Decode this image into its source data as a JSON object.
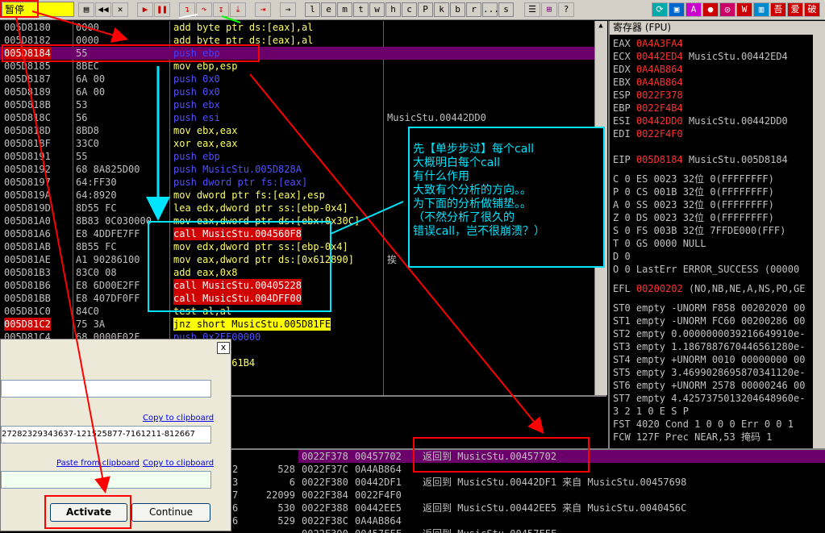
{
  "toolbar": {
    "state": "暂停",
    "letters": [
      "l",
      "e",
      "m",
      "t",
      "w",
      "h",
      "c",
      "P",
      "k",
      "b",
      "r",
      "...",
      "s"
    ]
  },
  "disasm": [
    {
      "addr": "005D8180",
      "hex": "0000",
      "dis": "add byte ptr ds:[eax],al",
      "cmt": ""
    },
    {
      "addr": "005D8182",
      "hex": "0000",
      "dis": "add byte ptr ds:[eax],al",
      "cmt": ""
    },
    {
      "addr": "005D8184",
      "hex": "55",
      "dis": "push ebp",
      "cmt": ""
    },
    {
      "addr": "005D8185",
      "hex": "8BEC",
      "dis": "mov ebp,esp",
      "cmt": ""
    },
    {
      "addr": "005D8187",
      "hex": "6A 00",
      "dis": "push 0x0",
      "cmt": ""
    },
    {
      "addr": "005D8189",
      "hex": "6A 00",
      "dis": "push 0x0",
      "cmt": ""
    },
    {
      "addr": "005D818B",
      "hex": "53",
      "dis": "push ebx",
      "cmt": ""
    },
    {
      "addr": "005D818C",
      "hex": "56",
      "dis": "push esi",
      "cmt": "MusicStu.00442DD0"
    },
    {
      "addr": "005D818D",
      "hex": "8BD8",
      "dis": "mov ebx,eax",
      "cmt": ""
    },
    {
      "addr": "005D818F",
      "hex": "33C0",
      "dis": "xor eax,eax",
      "cmt": ""
    },
    {
      "addr": "005D8191",
      "hex": "55",
      "dis": "push ebp",
      "cmt": ""
    },
    {
      "addr": "005D8192",
      "hex": "68 8A825D00",
      "dis": "push MusicStu.005D828A",
      "cmt": ""
    },
    {
      "addr": "005D8197",
      "hex": "64:FF30",
      "dis": "push dword ptr fs:[eax]",
      "cmt": ""
    },
    {
      "addr": "005D819A",
      "hex": "64:8920",
      "dis": "mov dword ptr fs:[eax],esp",
      "cmt": ""
    },
    {
      "addr": "005D819D",
      "hex": "8D55 FC",
      "dis": "lea edx,dword ptr ss:[ebp-0x4]",
      "cmt": ""
    },
    {
      "addr": "005D81A0",
      "hex": "8B83 0C030000",
      "dis": "mov eax,dword ptr ds:[ebx+0x30C]",
      "cmt": ""
    },
    {
      "addr": "005D81A6",
      "hex": "E8 4DDFE7FF",
      "dis": "call MusicStu.004560F8",
      "cmt": ""
    },
    {
      "addr": "005D81AB",
      "hex": "8B55 FC",
      "dis": "mov edx,dword ptr ss:[ebp-0x4]",
      "cmt": ""
    },
    {
      "addr": "005D81AE",
      "hex": "A1 90286100",
      "dis": "mov eax,dword ptr ds:[0x612890]",
      "cmt": "挨"
    },
    {
      "addr": "005D81B3",
      "hex": "83C0 08",
      "dis": "add eax,0x8",
      "cmt": ""
    },
    {
      "addr": "005D81B6",
      "hex": "E8 6D00E2FF",
      "dis": "call MusicStu.00405228",
      "cmt": ""
    },
    {
      "addr": "005D81BB",
      "hex": "E8 407DF0FF",
      "dis": "call MusicStu.004DFF00",
      "cmt": ""
    },
    {
      "addr": "005D81C0",
      "hex": "84C0",
      "dis": "test al,al",
      "cmt": ""
    },
    {
      "addr": "005D81C2",
      "hex": "75 3A",
      "dis": "jnz short MusicStu.005D81FE",
      "cmt": ""
    },
    {
      "addr": "005D81C4",
      "hex": "68 0000F02F",
      "dis": "push 0x2FF00000",
      "cmt": ""
    },
    {
      "addr": "",
      "hex": "",
      "dis": "ax",
      "cmt": ""
    },
    {
      "addr": "",
      "hex": "",
      "dis": "icStu.005261B4",
      "cmt": ""
    },
    {
      "addr": "",
      "hex": "",
      "dis": "ax",
      "cmt": ""
    }
  ],
  "registers": {
    "title": "寄存器 (FPU)",
    "gp": [
      {
        "name": "EAX",
        "val": "0A4A3FA4",
        "extra": ""
      },
      {
        "name": "ECX",
        "val": "00442ED4",
        "extra": "MusicStu.00442ED4"
      },
      {
        "name": "EDX",
        "val": "0A4AB864",
        "extra": ""
      },
      {
        "name": "EBX",
        "val": "0A4AB864",
        "extra": ""
      },
      {
        "name": "ESP",
        "val": "0022F378",
        "extra": ""
      },
      {
        "name": "EBP",
        "val": "0022F4B4",
        "extra": ""
      },
      {
        "name": "ESI",
        "val": "00442DD0",
        "extra": "MusicStu.00442DD0"
      },
      {
        "name": "EDI",
        "val": "0022F4F0",
        "extra": ""
      }
    ],
    "eip": {
      "name": "EIP",
      "val": "005D8184",
      "extra": "MusicStu.005D8184"
    },
    "flags": [
      "C 0  ES 0023 32位 0(FFFFFFFF)",
      "P 0  CS 001B 32位 0(FFFFFFFF)",
      "A 0  SS 0023 32位 0(FFFFFFFF)",
      "Z 0  DS 0023 32位 0(FFFFFFFF)",
      "S 0  FS 003B 32位 7FFDE000(FFF)",
      "T 0  GS 0000 NULL",
      "D 0",
      "O 0  LastErr ERROR_SUCCESS (00000"
    ],
    "efl": {
      "label": "EFL",
      "val": "00200202",
      "extra": "(NO,NB,NE,A,NS,PO,GE"
    },
    "fpu": [
      "ST0 empty -UNORM F858 00202020 00",
      "ST1 empty -UNORM FC60 00200286 00",
      "ST2 empty 0.0000000039216649910e-",
      "ST3 empty 1.1867887670446561280e-",
      "ST4 empty +UNORM 0010 00000000 00",
      "ST5 empty 3.4699028695870341120e-",
      "ST6 empty +UNORM 2578 00000246 00",
      "ST7 empty 4.4257375013204648960e-"
    ],
    "fpu_hdr": "           3 2 1 0        E S P",
    "fst": "FST 4020  Cond 1 0 0 0  Err 0 0 1",
    "fcw": "FCW 127F  Prec NEAR,53  掩码    1"
  },
  "stack": [
    {
      "addr": "0022F378",
      "val": "00457702",
      "cmt": "返回到 MusicStu.00457702"
    },
    {
      "addr": "0022F37C",
      "val": "0A4AB864",
      "cmt": ""
    },
    {
      "addr": "0022F380",
      "val": "00442DF1",
      "cmt": "返回到 MusicStu.00442DF1 来自 MusicStu.00457698"
    },
    {
      "addr": "0022F384",
      "val": "0022F4F0",
      "cmt": ""
    },
    {
      "addr": "0022F388",
      "val": "00442EE5",
      "cmt": "返回到 MusicStu.00442EE5 来自 MusicStu.0040456C"
    },
    {
      "addr": "0022F38C",
      "val": "0A4AB864",
      "cmt": ""
    },
    {
      "addr": "0022F390",
      "val": "00457FFF",
      "cmt": "返回到 MusicStu.00457FFF"
    }
  ],
  "dump": [
    {
      "a": "2",
      "b": "528"
    },
    {
      "a": "3",
      "b": "6"
    },
    {
      "a": "7",
      "b": "22099"
    },
    {
      "a": "6",
      "b": "530"
    },
    {
      "a": "6",
      "b": "529"
    }
  ],
  "dialog": {
    "field1": "",
    "serial": "27282329343637-121525877-7161211-812667",
    "copy1": "Copy to clipboard",
    "paste": "Paste from clipboard",
    "copy2": "Copy to clipboard",
    "field3": "",
    "activate": "Activate",
    "continue": "Continue",
    "close": "x"
  },
  "annotation": {
    "lines": [
      "先【单步步过】每个call",
      "大概明白每个call",
      "有什么作用",
      "大致有个分析的方向。。",
      "为下面的分析做铺垫。。",
      "（不然分析了很久的",
      "错误call，岂不很崩溃？）"
    ]
  },
  "colors": {
    "accent": "#ff0000",
    "annotation": "#00e5ff",
    "selection": "#6b006b"
  }
}
